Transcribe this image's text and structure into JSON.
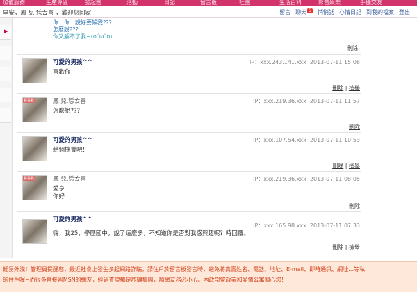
{
  "nav": [
    "加值服務",
    "生產專區",
    "發起團",
    "活動",
    "日記",
    "留言板",
    "社團",
    "生活百科",
    "影音娛樂",
    "手機交友"
  ],
  "greeting": "早安，鳳 兒.恁ㄊ喜 ，歡迎您回家",
  "toplinks": [
    {
      "label": "留言"
    },
    {
      "label": "聊天",
      "badge": "5"
    },
    {
      "label": "悄悄話"
    },
    {
      "label": "心情日記"
    },
    {
      "label": "到我的檔案"
    },
    {
      "label": "登出"
    }
  ],
  "partial": {
    "lines": [
      "你…你…說好要帳我???",
      "怎麼說???",
      "你又解不了我~(o´ω`o)"
    ],
    "delete": "刪除"
  },
  "entries": [
    {
      "name": "可愛的男孩^^",
      "ip": "IP：xxx.243.141.xxx",
      "date": "2013-07-11 15:08",
      "message": "喜歡你",
      "reply": "刪除",
      "report": "檢舉",
      "highlight": true,
      "tag": ""
    },
    {
      "name": "鳳 兒.恁ㄊ喜",
      "ip": "IP：xxx.219.36.xxx",
      "date": "2013-07-11 11:57",
      "message": "怎麼說???",
      "reply": "刪除",
      "report": "",
      "highlight": false,
      "tag": "看看我"
    },
    {
      "name": "可愛的男孩^^",
      "ip": "IP：xxx.107.54.xxx",
      "date": "2013-07-11 10:53",
      "message": "給個機會吧！",
      "reply": "刪除",
      "report": "檢舉",
      "highlight": true,
      "tag": ""
    },
    {
      "name": "鳳 兒.恁ㄊ喜",
      "ip": "IP：xxx.219.36.xxx",
      "date": "2013-07-11 08:05",
      "message": "愛亨\n你好",
      "reply": "刪除",
      "report": "",
      "highlight": false,
      "tag": "看看我"
    },
    {
      "name": "可愛的男孩^^",
      "ip": "IP：xxx.165.98.xxx",
      "date": "2013-07-11 07:33",
      "message": "嗨，我25，學歷國中，說了這麼多，不知道你是否對我感興趣呢？時回覆。",
      "reply": "刪除",
      "report": "檢舉",
      "highlight": true,
      "tag": ""
    }
  ],
  "notice": {
    "line1": "輕易外洩！管理員提醒您，最近社會上發生多起網路詐騙，請住戶於留言板發言時，避免將真實姓名、電話、地址、E-mail、即時通訊、網址…等私",
    "line2": "的住戶喔~而很多直接留MSN的網友，經過查證都是詐騙集團，請網友務必小心。內政部警政署和愛情公寓關心您！"
  },
  "colors": {
    "brand": "#d2336a",
    "notice_bg": "#fde8d9",
    "notice_text": "#d4411b",
    "name": "#1d2f66"
  }
}
